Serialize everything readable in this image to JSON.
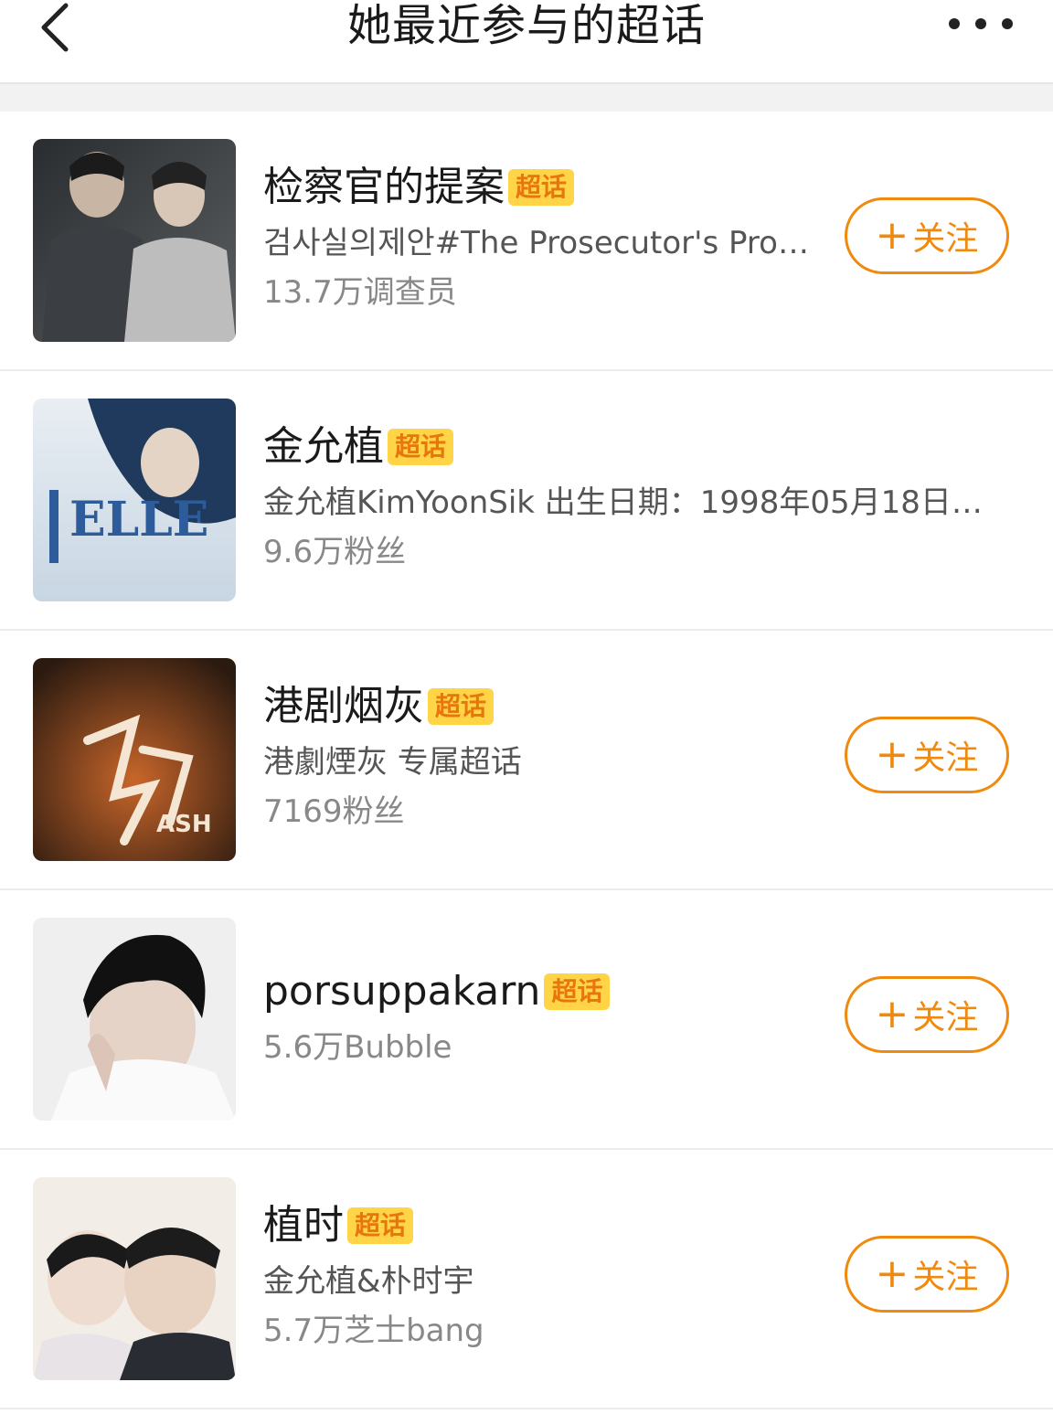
{
  "header": {
    "title": "她最近参与的超话",
    "back_icon": "chevron-left-icon",
    "more_icon": "more-horizontal-icon"
  },
  "colors": {
    "accent": "#f08a0e",
    "badge_bg": "#ffd447",
    "badge_text": "#e8760e"
  },
  "topics": [
    {
      "name": "检察官的提案",
      "badge": "超话",
      "description": "검사실의제안#The Prosecutor's Pro…",
      "count": "13.7万调查员",
      "follow_label": "关注",
      "has_follow": true
    },
    {
      "name": "金允植",
      "badge": "超话",
      "description": "金允植KimYoonSik 出生日期：1998年05月18日…",
      "count": "9.6万粉丝",
      "follow_label": "",
      "has_follow": false
    },
    {
      "name": "港剧烟灰",
      "badge": "超话",
      "description": "港劇煙灰 专属超话",
      "count": "7169粉丝",
      "follow_label": "关注",
      "has_follow": true
    },
    {
      "name": "porsuppakarn",
      "badge": "超话",
      "description": "",
      "count": "5.6万Bubble",
      "follow_label": "关注",
      "has_follow": true
    },
    {
      "name": "植时",
      "badge": "超话",
      "description": "金允植&朴时宇",
      "count": "5.7万芝士bang",
      "follow_label": "关注",
      "has_follow": true
    }
  ]
}
